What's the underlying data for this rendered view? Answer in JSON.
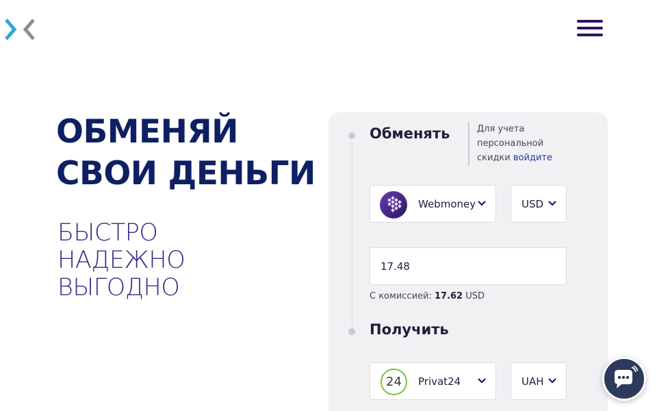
{
  "header": {
    "logo_icon": "exchange-chevrons-logo",
    "menu_icon": "hamburger-menu-icon"
  },
  "hero": {
    "title_line1": "ОБМЕНЯЙ",
    "title_line2": "СВОИ ДЕНЬГИ",
    "benefits": [
      "БЫСТРО",
      "НАДЕЖНО",
      "ВЫГОДНО"
    ]
  },
  "exchange": {
    "give_title": "Обменять",
    "discount_line1": "Для учета",
    "discount_line2": "персональной",
    "discount_line3": "скидки",
    "discount_link": "войдите",
    "give_method": "Webmoney",
    "give_currency": "USD",
    "amount": "17.48",
    "commission_label": "С комиссией:",
    "commission_value": "17.62",
    "commission_currency": "USD",
    "get_title": "Получить",
    "get_method": "Privat24",
    "get_method_badge": "24",
    "get_currency": "UAH"
  },
  "colors": {
    "brand_dark": "#0f1f63",
    "accent_purple": "#3a2a86",
    "link": "#263a9c",
    "privat_green": "#7cbf3a",
    "webmoney_purple": "#4c2a8c"
  },
  "chat": {
    "icon": "chat-bubble-icon"
  }
}
